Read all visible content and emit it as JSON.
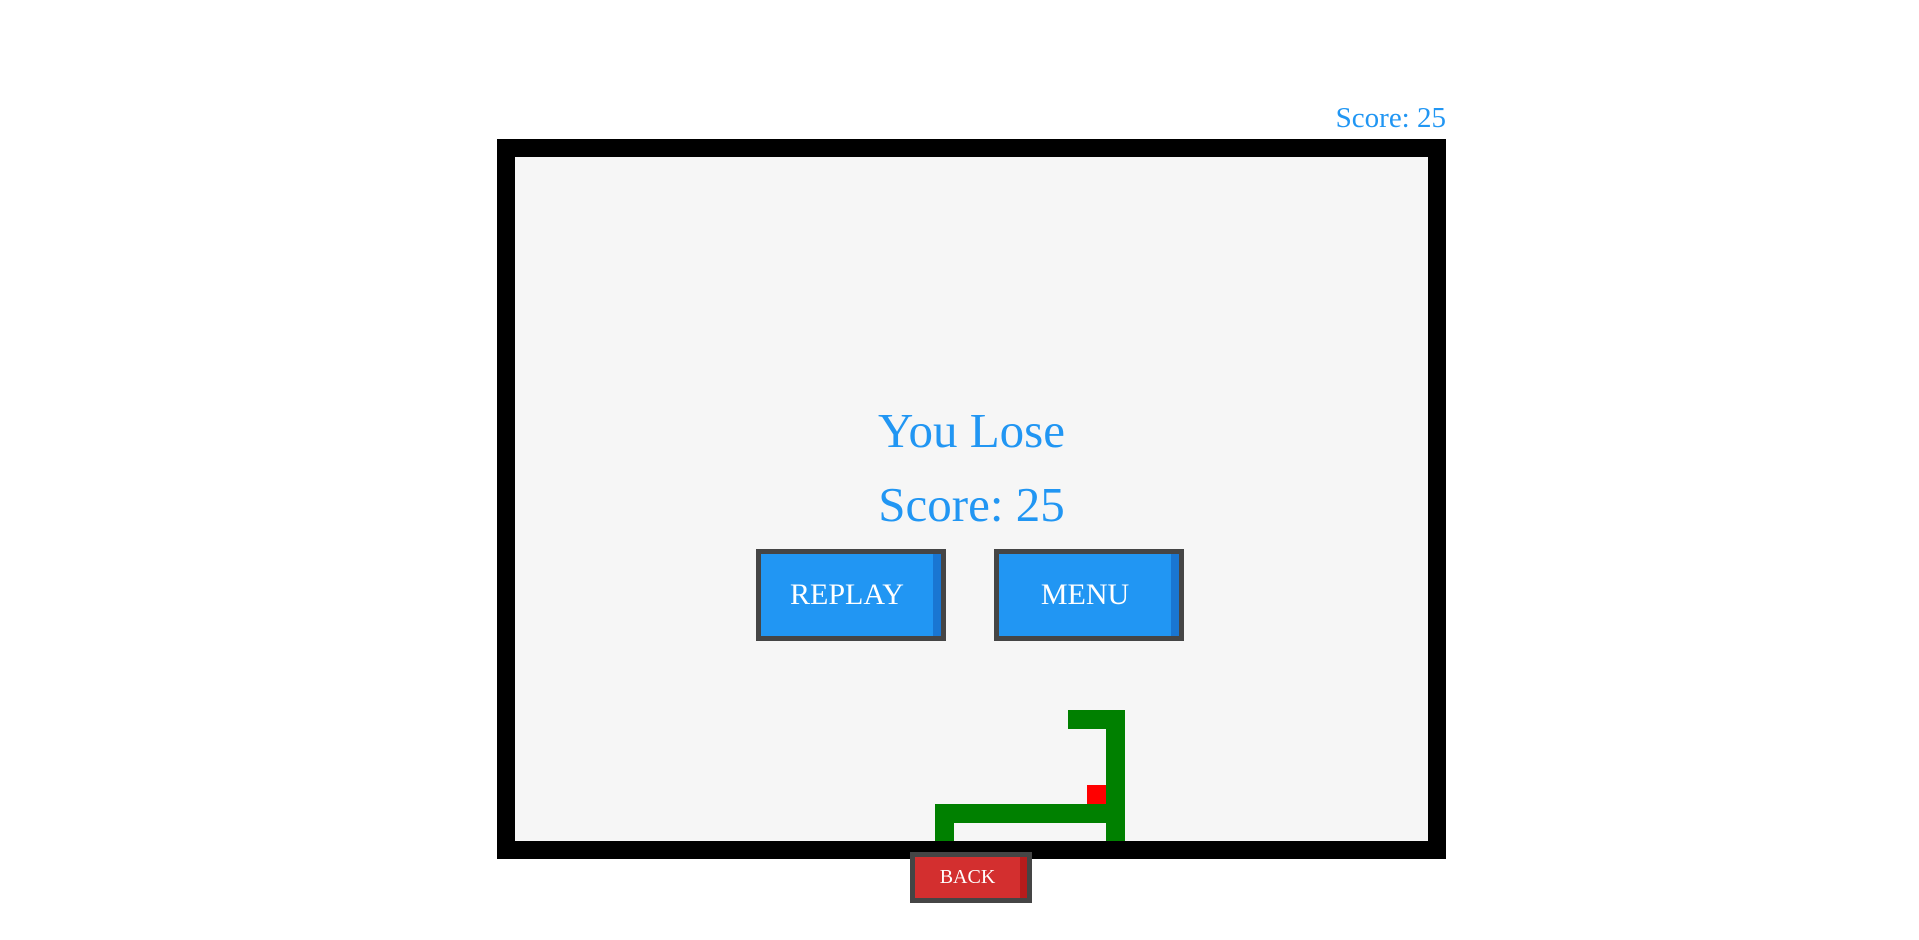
{
  "hud": {
    "score_label": "Score: 25"
  },
  "game_over": {
    "title": "You Lose",
    "score_label": "Score: 25",
    "replay_label": "REPLAY",
    "menu_label": "MENU"
  },
  "controls": {
    "back_label": "BACK"
  },
  "colors": {
    "accent": "#2196f3",
    "snake": "#008000",
    "food": "#ff0000",
    "board_border": "#000000",
    "board_background": "#f6f6f6",
    "back_button": "#d32f2f"
  },
  "game_state": {
    "score": 25,
    "status": "lost"
  }
}
